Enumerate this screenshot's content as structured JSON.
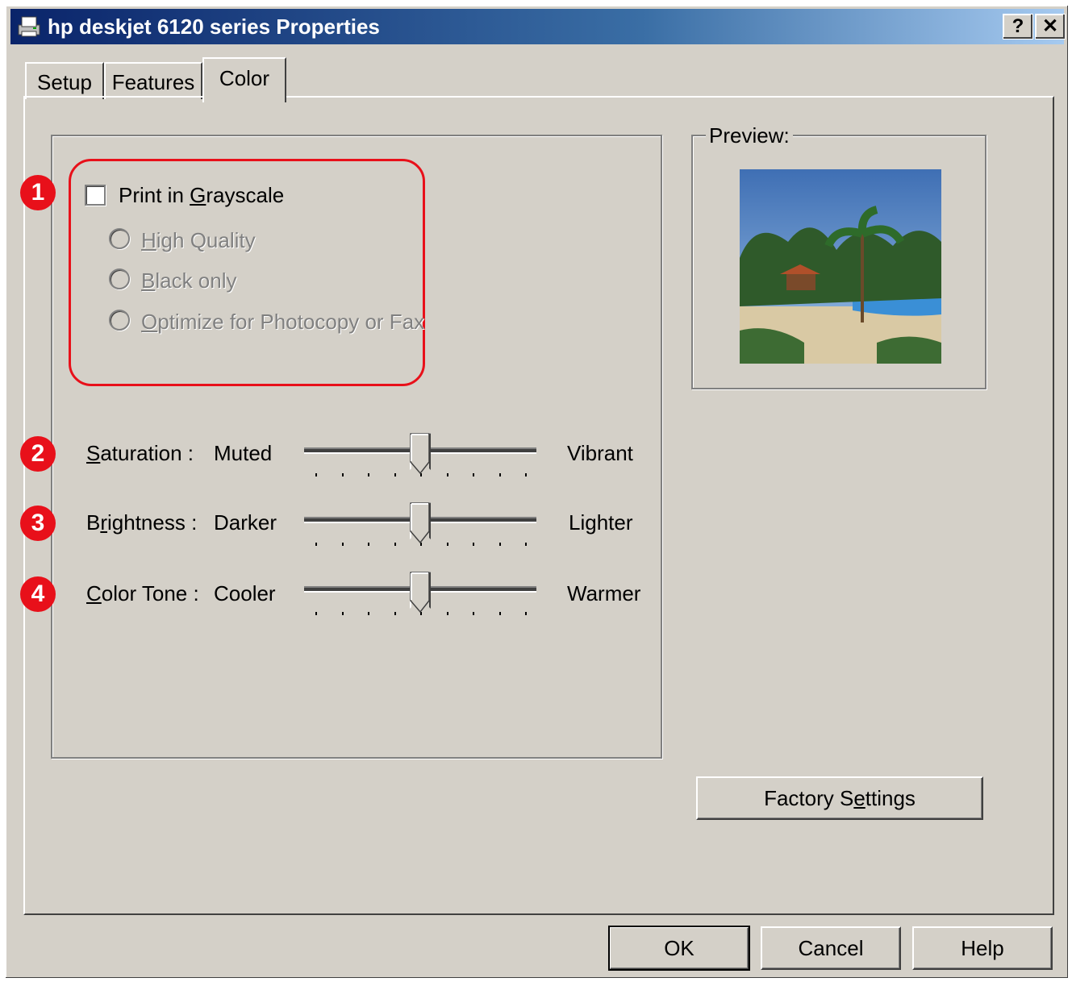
{
  "window": {
    "title": "hp deskjet 6120 series Properties",
    "help_glyph": "?",
    "close_glyph": "✕"
  },
  "tabs": [
    {
      "label": "Setup",
      "active": false
    },
    {
      "label": "Features",
      "active": false
    },
    {
      "label": "Color",
      "active": true
    }
  ],
  "grayscale": {
    "checkbox_label_pre": "Print in ",
    "checkbox_label_accel": "G",
    "checkbox_label_post": "rayscale",
    "checked": false,
    "options": [
      {
        "accel": "H",
        "rest": "igh Quality",
        "enabled": false
      },
      {
        "accel": "B",
        "rest": "lack only",
        "enabled": false
      },
      {
        "accel": "O",
        "rest": "ptimize for Photocopy or Fax",
        "enabled": false
      }
    ]
  },
  "markers": [
    "1",
    "2",
    "3",
    "4"
  ],
  "sliders": [
    {
      "accel": "S",
      "rest": "aturation :",
      "low": "Muted",
      "high": "Vibrant",
      "position": 0.5
    },
    {
      "accel": "r",
      "pre": "B",
      "rest": "ightness :",
      "low": "Darker",
      "high": "Lighter",
      "position": 0.5
    },
    {
      "accel": "C",
      "rest": "olor Tone :",
      "low": "Cooler",
      "high": "Warmer",
      "position": 0.5
    }
  ],
  "preview": {
    "label": "Preview:",
    "image_icon": "resort-beach-photo"
  },
  "factory_button": {
    "pre": "Factory S",
    "accel": "e",
    "post": "ttings"
  },
  "buttons": {
    "ok": "OK",
    "cancel": "Cancel",
    "help": "Help"
  },
  "colors": {
    "accent_red": "#e8101a",
    "face": "#d4d0c8",
    "title_start": "#0a246a",
    "title_end": "#a6caf0"
  }
}
